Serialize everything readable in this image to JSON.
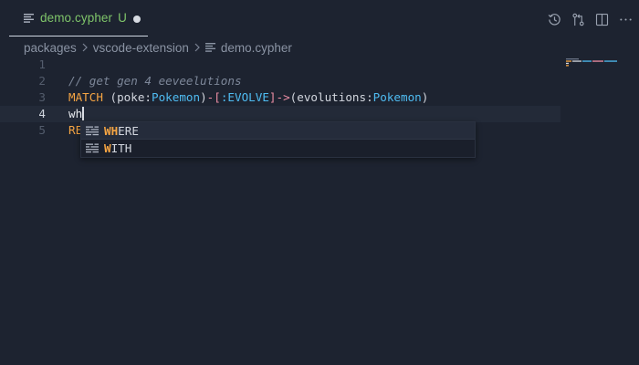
{
  "tab": {
    "filename": "demo.cypher",
    "status": "U",
    "icon": "file-text-icon",
    "color": "#7fc56a"
  },
  "breadcrumb": {
    "parts": [
      "packages",
      "vscode-extension",
      "demo.cypher"
    ]
  },
  "editor": {
    "lines": [
      {
        "num": "1",
        "tokens": []
      },
      {
        "num": "2",
        "tokens": [
          {
            "t": "// get gen 4 eeveelutions",
            "c": "t-comment"
          }
        ]
      },
      {
        "num": "3",
        "tokens": [
          {
            "t": "MATCH",
            "c": "t-kw"
          },
          {
            "t": " (poke:",
            "c": "t-plain"
          },
          {
            "t": "Pokemon",
            "c": "t-type"
          },
          {
            "t": ")",
            "c": "t-plain"
          },
          {
            "t": "-[",
            "c": "t-op"
          },
          {
            "t": ":EVOLVE",
            "c": "t-rel"
          },
          {
            "t": "]->",
            "c": "t-op"
          },
          {
            "t": "(evolutions:",
            "c": "t-plain"
          },
          {
            "t": "Pokemon",
            "c": "t-type"
          },
          {
            "t": ")",
            "c": "t-plain"
          }
        ]
      },
      {
        "num": "4",
        "tokens": [
          {
            "t": "wh",
            "c": "t-typed"
          }
        ],
        "current": true
      },
      {
        "num": "5",
        "tokens": [
          {
            "t": "RE",
            "c": "t-kw"
          }
        ]
      }
    ]
  },
  "suggest": {
    "items": [
      {
        "match": "WH",
        "rest": "ERE",
        "icon": "keyword-icon"
      },
      {
        "match": "W",
        "rest": "ITH",
        "icon": "keyword-icon"
      }
    ]
  },
  "colors": {
    "background": "#1d2330",
    "keyword": "#f6a543",
    "type": "#4fbcf2",
    "operator": "#ef8fa6",
    "comment": "#7d8799",
    "modified_green": "#7fc56a"
  }
}
